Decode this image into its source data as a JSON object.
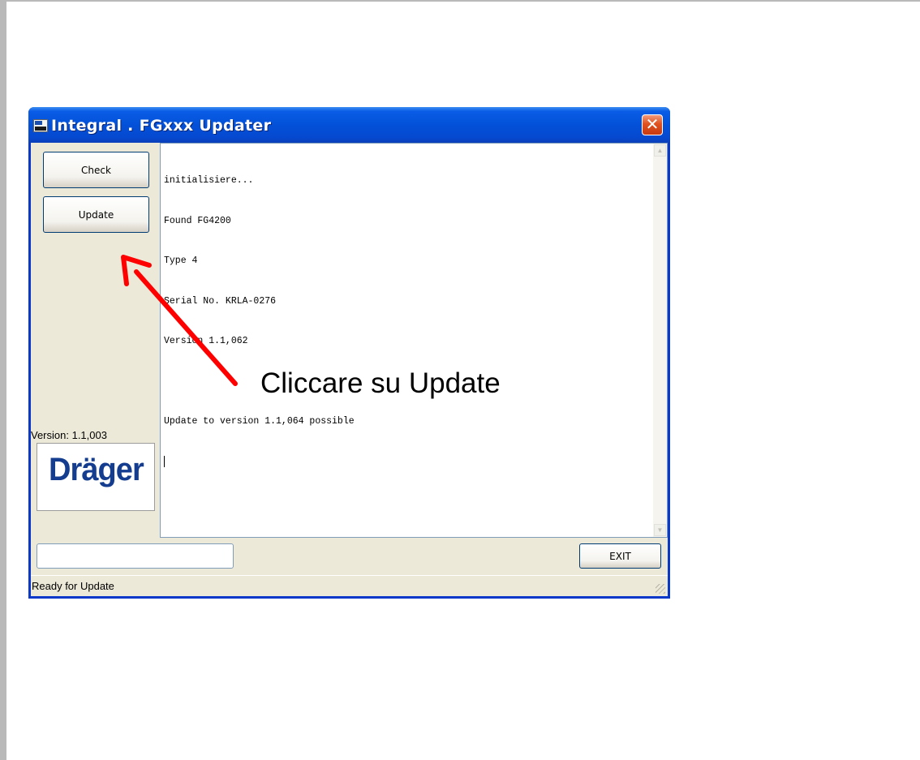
{
  "window": {
    "title": "Integral . FGxxx  Updater",
    "close_label": "✕"
  },
  "sidebar": {
    "check_label": "Check",
    "update_label": "Update",
    "version_label": "Version: 1.1,003",
    "logo_text": "Dräger"
  },
  "log": {
    "lines": [
      "initialisiere...",
      "Found FG4200",
      "Type 4",
      "Serial No. KRLA-0276",
      "Version 1.1,062",
      "",
      "Update to version 1.1,064 possible"
    ]
  },
  "footer": {
    "progress_value": "",
    "exit_label": "EXIT",
    "status_text": "Ready for Update"
  },
  "annotation": {
    "text": "Cliccare su Update",
    "arrow_color": "#ff0000"
  },
  "icons": {
    "app": "drager-app-icon",
    "close": "close-icon",
    "scroll_up": "scroll-up-arrow-icon",
    "scroll_down": "scroll-down-arrow-icon"
  }
}
